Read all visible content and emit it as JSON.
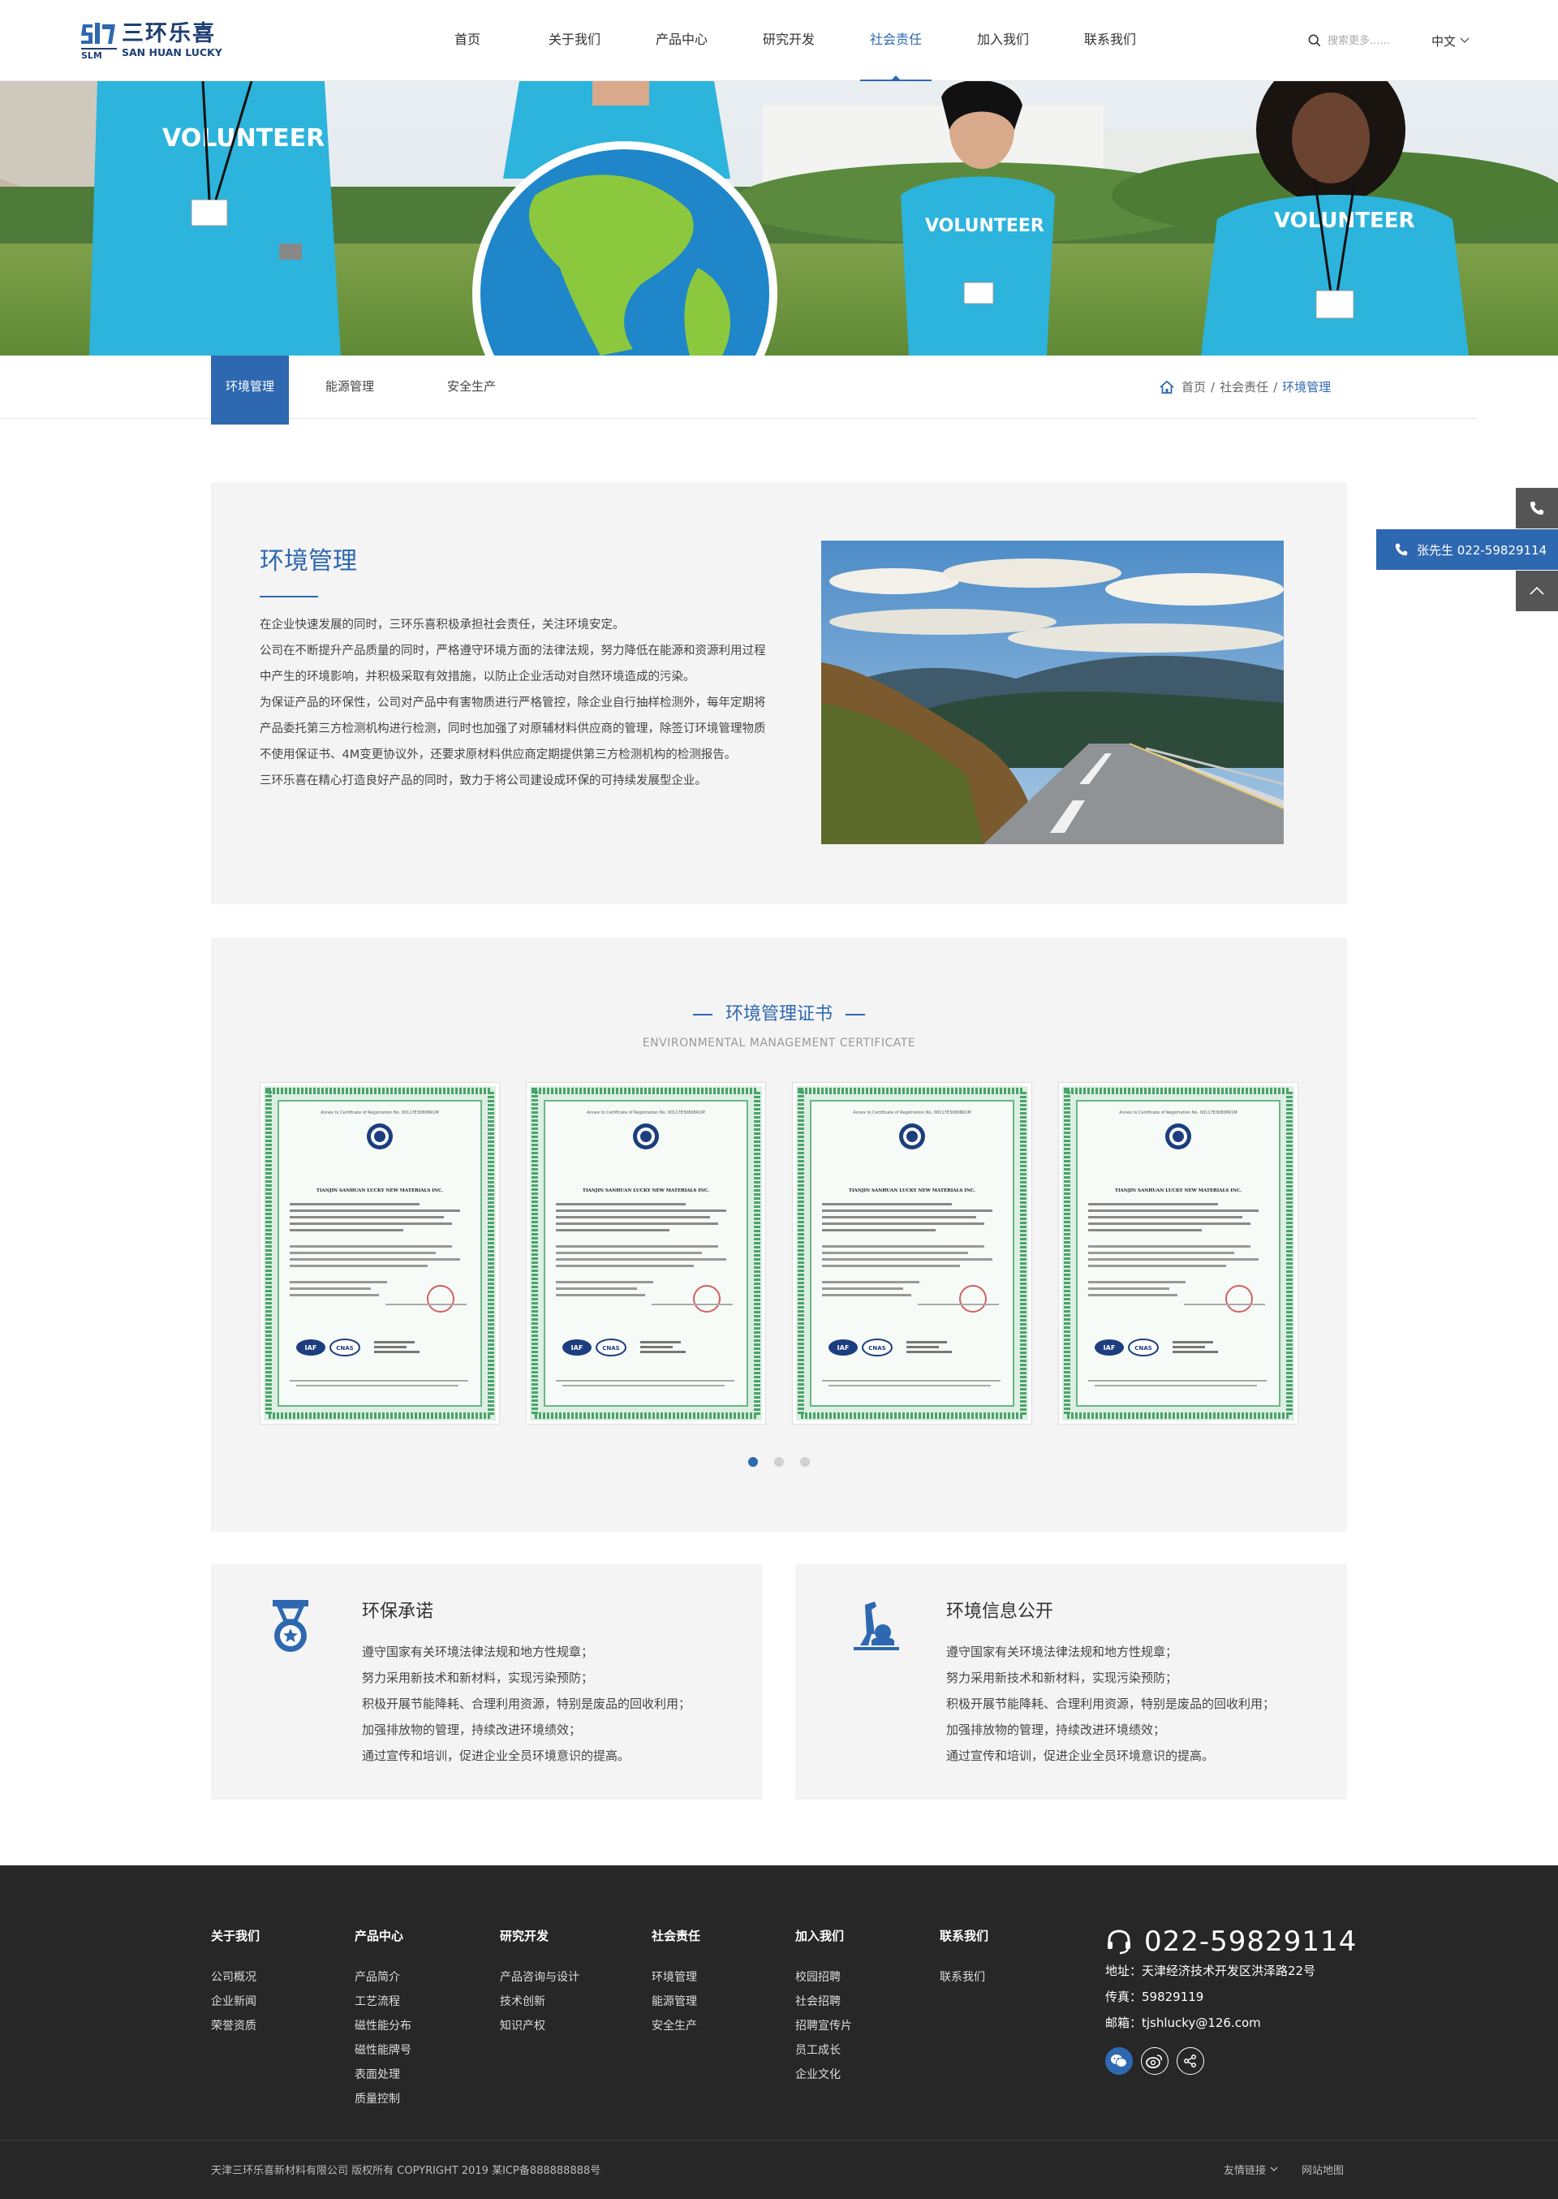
{
  "header": {
    "logo_cn": "三环乐喜",
    "logo_en": "SAN HUAN LUCKY",
    "nav": [
      "首页",
      "关于我们",
      "产品中心",
      "研究开发",
      "社会责任",
      "加入我们",
      "联系我们"
    ],
    "active_nav_index": 4,
    "search_placeholder": "搜索更多......",
    "language": "中文"
  },
  "banner": {
    "shirt_text": "VOLUNTEER"
  },
  "subnav": {
    "tabs": [
      "环境管理",
      "能源管理",
      "安全生产"
    ],
    "active_tab_index": 0,
    "breadcrumb": [
      "首页",
      "社会责任",
      "环境管理"
    ]
  },
  "float": {
    "phone_label": "张先生 022-59829114"
  },
  "intro": {
    "title": "环境管理",
    "paragraphs": [
      "在企业快速发展的同时，三环乐喜积极承担社会责任，关注环境安定。",
      "公司在不断提升产品质量的同时，严格遵守环境方面的法律法规，努力降低在能源和资源利用过程中产生的环境影响，并积极采取有效措施，以防止企业活动对自然环境造成的污染。",
      "为保证产品的环保性，公司对产品中有害物质进行严格管控，除企业自行抽样检测外，每年定期将产品委托第三方检测机构进行检测，同时也加强了对原辅材料供应商的管理，除签订环境管理物质不使用保证书、4M变更协议外，还要求原材料供应商定期提供第三方检测机构的检测报告。",
      "三环乐喜在精心打造良好产品的同时，致力于将公司建设成环保的可持续发展型企业。"
    ]
  },
  "certificates": {
    "title": "环境管理证书",
    "subtitle": "ENVIRONMENTAL MANAGEMENT CERTIFICATE",
    "items": [
      {
        "company": "TIANJIN SANHUAN LUCKY NEW MATERIALS INC.",
        "header": "Annex to Certificate of Registration No. 00117E30808R1M",
        "iaf": "IAF",
        "cnas": "CNAS"
      },
      {
        "company": "TIANJIN SANHUAN LUCKY NEW MATERIALS INC.",
        "header": "Annex to Certificate of Registration No. 00117E30808R1M",
        "iaf": "IAF",
        "cnas": "CNAS"
      },
      {
        "company": "TIANJIN SANHUAN LUCKY NEW MATERIALS INC.",
        "header": "Annex to Certificate of Registration No. 00117E30808R1M",
        "iaf": "IAF",
        "cnas": "CNAS"
      },
      {
        "company": "TIANJIN SANHUAN LUCKY NEW MATERIALS INC.",
        "header": "Annex to Certificate of Registration No. 00117E30808R1M",
        "iaf": "IAF",
        "cnas": "CNAS"
      }
    ],
    "page_count": 3,
    "active_page": 0
  },
  "cards": [
    {
      "title": "环保承诺",
      "icon": "medal-icon",
      "items": [
        "遵守国家有关环境法律法规和地方性规章；",
        "努力采用新技术和新材料，实现污染预防；",
        "积极开展节能降耗、合理利用资源，特别是废品的回收利用；",
        "加强排放物的管理，持续改进环境绩效；",
        "通过宣传和培训，促进企业全员环境意识的提高。"
      ]
    },
    {
      "title": "环境信息公开",
      "icon": "scientist-icon",
      "items": [
        "遵守国家有关环境法律法规和地方性规章；",
        "努力采用新技术和新材料，实现污染预防；",
        "积极开展节能降耗、合理利用资源，特别是废品的回收利用；",
        "加强排放物的管理，持续改进环境绩效；",
        "通过宣传和培训，促进企业全员环境意识的提高。"
      ]
    }
  ],
  "footer": {
    "columns": [
      {
        "title": "关于我们",
        "items": [
          "公司概况",
          "企业新闻",
          "荣誉资质"
        ]
      },
      {
        "title": "产品中心",
        "items": [
          "产品简介",
          "工艺流程",
          "磁性能分布",
          "磁性能牌号",
          "表面处理",
          "质量控制"
        ]
      },
      {
        "title": "研究开发",
        "items": [
          "产品咨询与设计",
          "技术创新",
          "知识产权"
        ]
      },
      {
        "title": "社会责任",
        "items": [
          "环境管理",
          "能源管理",
          "安全生产"
        ]
      },
      {
        "title": "加入我们",
        "items": [
          "校园招聘",
          "社会招聘",
          "招聘宣传片",
          "员工成长",
          "企业文化"
        ]
      },
      {
        "title": "联系我们",
        "items": [
          "联系我们"
        ]
      }
    ],
    "phone": "022-59829114",
    "address": "地址：天津经济技术开发区洪泽路22号",
    "fax": "传真：59829119",
    "email": "邮箱：tjshlucky@126.com",
    "copyright": "天津三环乐喜新材料有限公司 版权所有 COPYRIGHT 2019  某ICP备888888888号",
    "friends_link": "友情链接",
    "sitemap": "网站地图"
  }
}
